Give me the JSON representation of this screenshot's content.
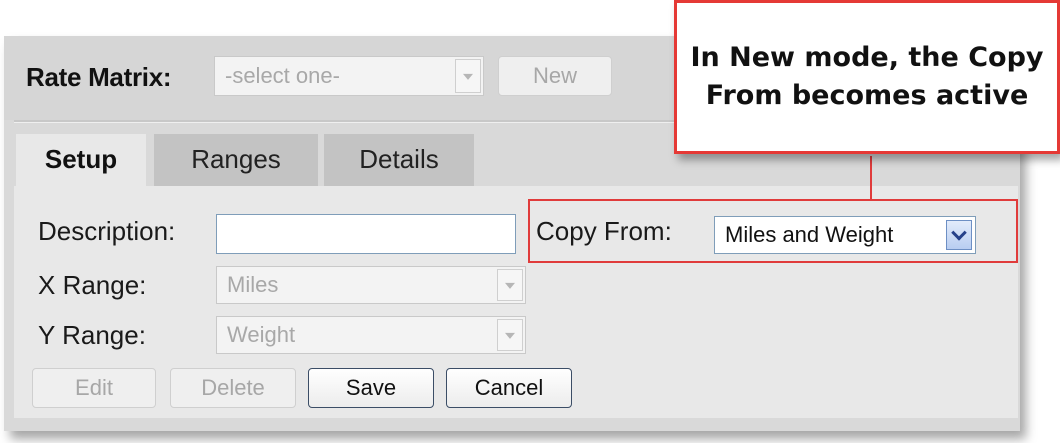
{
  "header": {
    "rate_matrix_label": "Rate Matrix:",
    "rate_matrix_select": {
      "value": "-select one-",
      "disabled": true
    },
    "new_button_label": "New"
  },
  "tabs": [
    {
      "label": "Setup",
      "active": true
    },
    {
      "label": "Ranges",
      "active": false
    },
    {
      "label": "Details",
      "active": false
    }
  ],
  "form": {
    "description_label": "Description:",
    "description_value": "",
    "copy_from_label": "Copy From:",
    "copy_from_value": "Miles and Weight",
    "x_range_label": "X Range:",
    "x_range_value": "Miles",
    "y_range_label": "Y Range:",
    "y_range_value": "Weight"
  },
  "buttons": {
    "edit": "Edit",
    "delete": "Delete",
    "save": "Save",
    "cancel": "Cancel"
  },
  "callout": {
    "text": "In New mode, the Copy\nFrom becomes active",
    "color": "#e53935"
  }
}
